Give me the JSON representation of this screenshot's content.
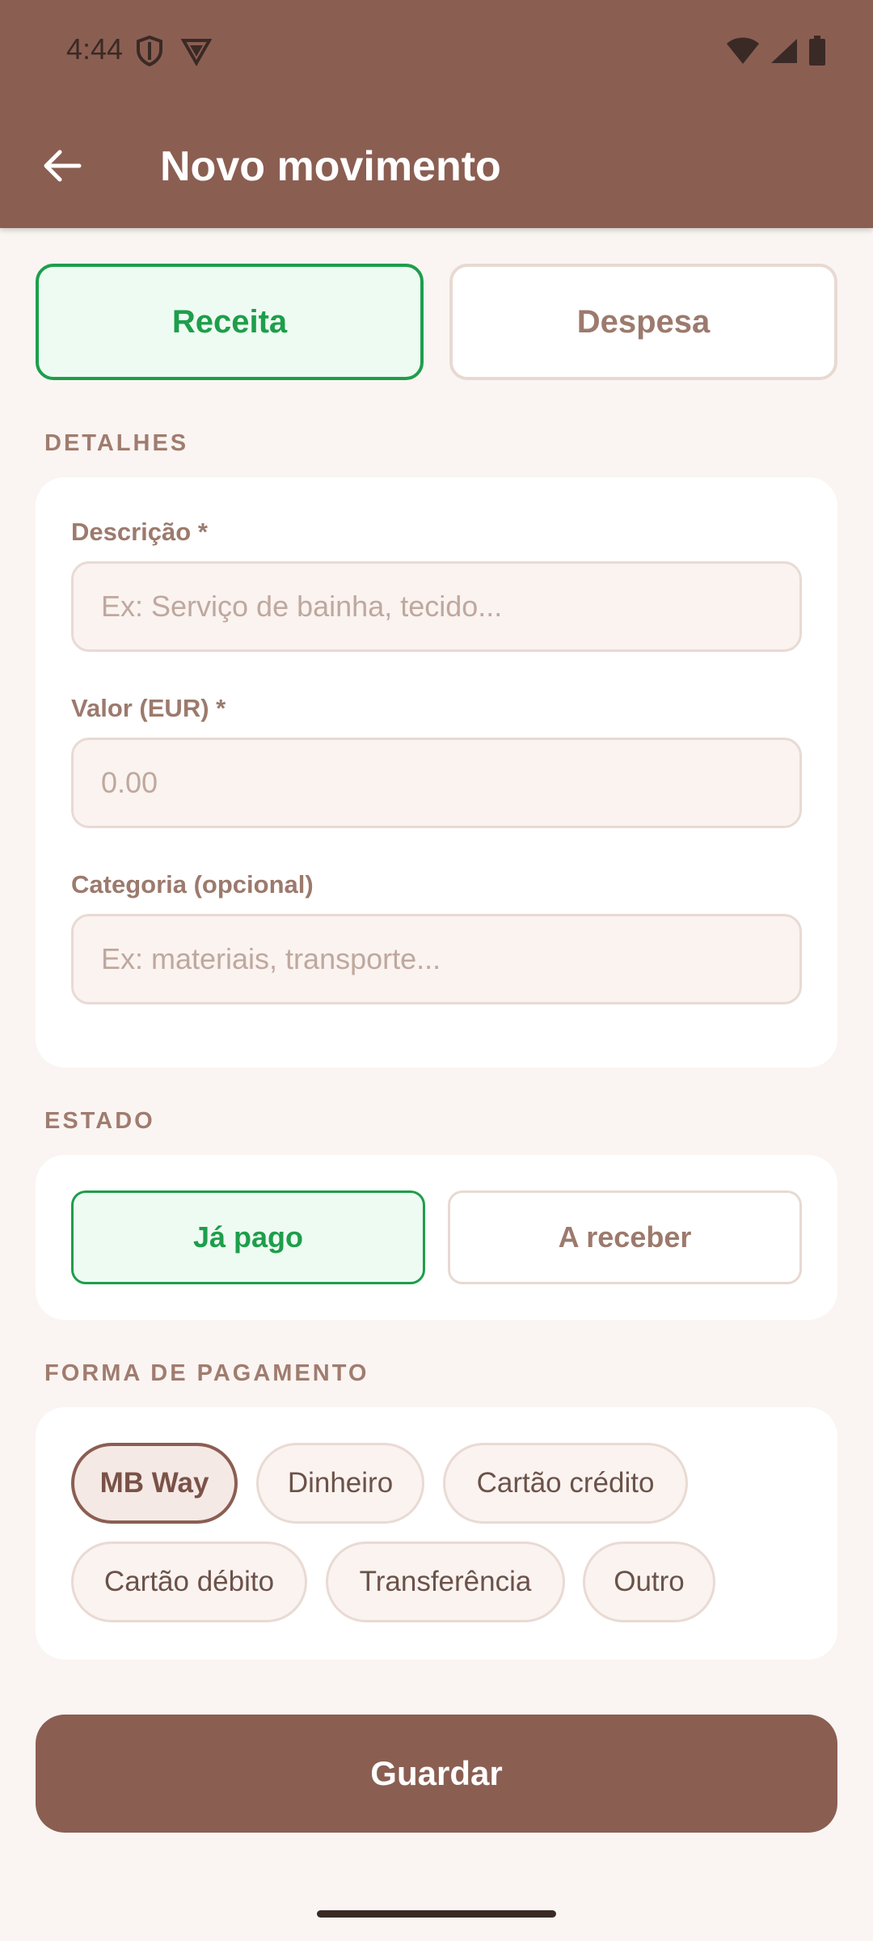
{
  "status_bar": {
    "time": "4:44"
  },
  "header": {
    "title": "Novo movimento",
    "back_icon": "arrow-back-icon"
  },
  "type_toggle": {
    "options": [
      "Receita",
      "Despesa"
    ],
    "selected": "Receita"
  },
  "details": {
    "section_label": "DETALHES",
    "description": {
      "label": "Descrição *",
      "value": "",
      "placeholder": "Ex: Serviço de bainha, tecido..."
    },
    "amount": {
      "label": "Valor (EUR) *",
      "value": "",
      "placeholder": "0.00"
    },
    "category": {
      "label": "Categoria (opcional)",
      "value": "",
      "placeholder": "Ex: materiais, transporte..."
    }
  },
  "state": {
    "section_label": "ESTADO",
    "options": [
      "Já pago",
      "A receber"
    ],
    "selected": "Já pago"
  },
  "payment": {
    "section_label": "FORMA DE PAGAMENTO",
    "options": [
      "MB Way",
      "Dinheiro",
      "Cartão crédito",
      "Cartão débito",
      "Transferência",
      "Outro"
    ],
    "selected": "MB Way"
  },
  "save_label": "Guardar",
  "colors": {
    "primary": "#8B5E52",
    "success": "#1E9E4B",
    "background": "#FAF5F2"
  }
}
